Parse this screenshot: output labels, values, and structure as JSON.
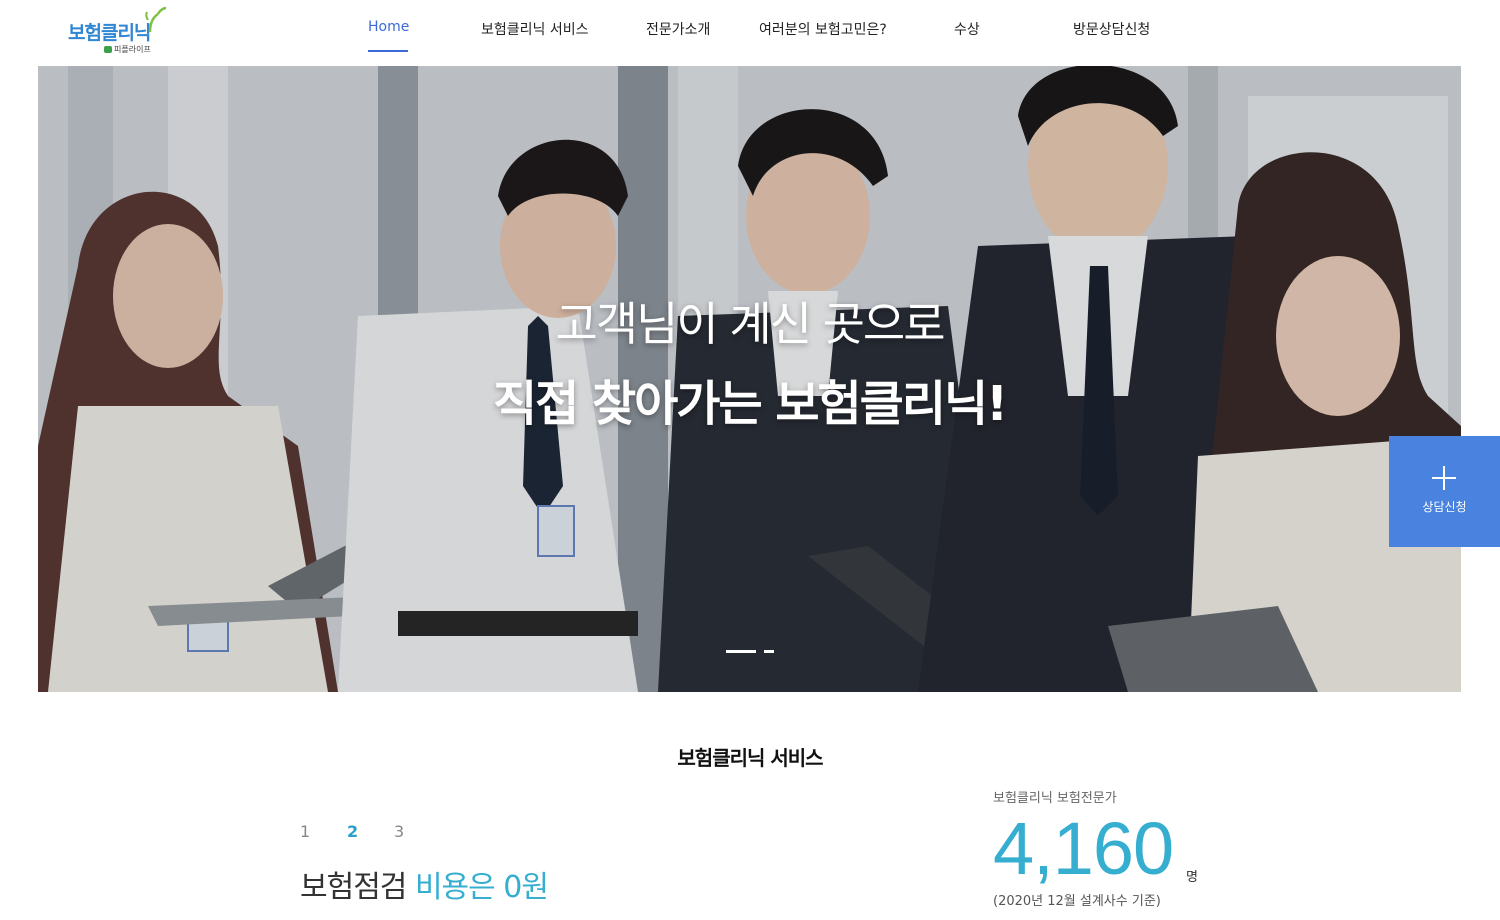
{
  "header": {
    "logo": {
      "main": "보험클리닉",
      "sub": "피플라이프"
    },
    "nav": [
      {
        "label": "Home",
        "active": true
      },
      {
        "label": "보험클리닉 서비스",
        "active": false
      },
      {
        "label": "전문가소개",
        "active": false
      },
      {
        "label": "여러분의 보험고민은?",
        "active": false
      },
      {
        "label": "수상",
        "active": false
      },
      {
        "label": "방문상담신청",
        "active": false
      }
    ]
  },
  "hero": {
    "line1": "고객님이 계신 곳으로",
    "line2": "직접 찾아가는 보험클리닉!",
    "slide_count": 2,
    "active_slide": 1
  },
  "consult": {
    "icon": "plus-icon",
    "label": "상담신청"
  },
  "service": {
    "title": "보험클리닉 서비스",
    "steps": [
      {
        "label": "1"
      },
      {
        "label": "2",
        "active": true
      },
      {
        "label": "3"
      }
    ],
    "feature": {
      "prefix": "보험점검",
      "accent": "비용은 0원"
    },
    "stat": {
      "label": "보험클리닉 보험전문가",
      "value": "4,160",
      "unit": "명",
      "note": "(2020년 12월 설계사수 기준)"
    }
  },
  "colors": {
    "accent": "#3c6ad6",
    "teal": "#36aed0",
    "consult": "#4a82e0",
    "logo": "#2f86d4"
  }
}
